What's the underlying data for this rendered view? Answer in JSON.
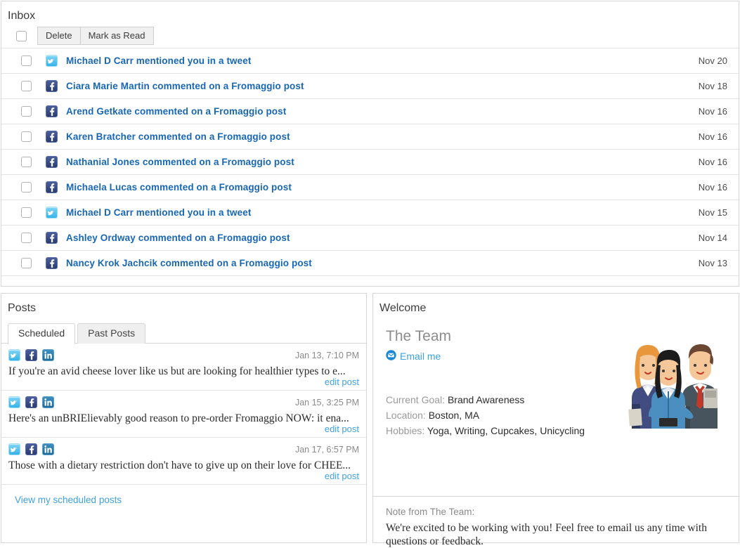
{
  "inbox": {
    "title": "Inbox",
    "toolbar": {
      "select_all_checkbox": "unchecked",
      "delete_label": "Delete",
      "mark_as_read_label": "Mark as Read"
    },
    "rows": [
      {
        "network": "twitter",
        "title": "Michael D Carr mentioned you in a tweet",
        "date": "Nov 20"
      },
      {
        "network": "facebook",
        "title": "Ciara Marie Martin commented on a Fromaggio post",
        "date": "Nov 18"
      },
      {
        "network": "facebook",
        "title": "Arend Getkate commented on a Fromaggio post",
        "date": "Nov 16"
      },
      {
        "network": "facebook",
        "title": "Karen Bratcher commented on a Fromaggio post",
        "date": "Nov 16"
      },
      {
        "network": "facebook",
        "title": "Nathanial Jones commented on a Fromaggio post",
        "date": "Nov 16"
      },
      {
        "network": "facebook",
        "title": "Michaela Lucas commented on a Fromaggio post",
        "date": "Nov 16"
      },
      {
        "network": "twitter",
        "title": "Michael D Carr mentioned you in a tweet",
        "date": "Nov 15"
      },
      {
        "network": "facebook",
        "title": "Ashley Ordway commented on a Fromaggio post",
        "date": "Nov 14"
      },
      {
        "network": "facebook",
        "title": "Nancy Krok Jachcik commented on a Fromaggio post",
        "date": "Nov 13"
      }
    ]
  },
  "posts": {
    "title": "Posts",
    "tabs": [
      {
        "label": "Scheduled",
        "active": true
      },
      {
        "label": "Past Posts",
        "active": false
      }
    ],
    "items": [
      {
        "date": "Jan 13, 7:10 PM",
        "text": "If you're an avid cheese lover like us but are looking for healthier types to e...",
        "edit_label": "edit post"
      },
      {
        "date": "Jan 15, 3:25 PM",
        "text": "Here's an unBRIElievably good reason to pre-order Fromaggio NOW: it ena...",
        "edit_label": "edit post"
      },
      {
        "date": "Jan 17, 6:57 PM",
        "text": "Those with a dietary restriction don't have to give up on their love for CHEE...",
        "edit_label": "edit post"
      }
    ],
    "footer_link": "View my scheduled posts"
  },
  "welcome": {
    "title": "Welcome",
    "team_name": "The Team",
    "email_link": "Email me",
    "meta": [
      {
        "label": "Current Goal:",
        "value": "Brand Awareness"
      },
      {
        "label": "Location:",
        "value": "Boston, MA"
      },
      {
        "label": "Hobbies:",
        "value": "Yoga, Writing, Cupcakes, Unicycling"
      }
    ],
    "note_label": "Note from The Team:",
    "note_text": "We're excited to be working with you! Feel free to email us any time with questions or feedback."
  },
  "colors": {
    "link_blue": "#1967b3",
    "accent_blue": "#3ea2e0",
    "twitter": "#36b4e8",
    "facebook": "#2b3c73",
    "linkedin": "#1c6a99",
    "border": "#d6d6d6"
  }
}
